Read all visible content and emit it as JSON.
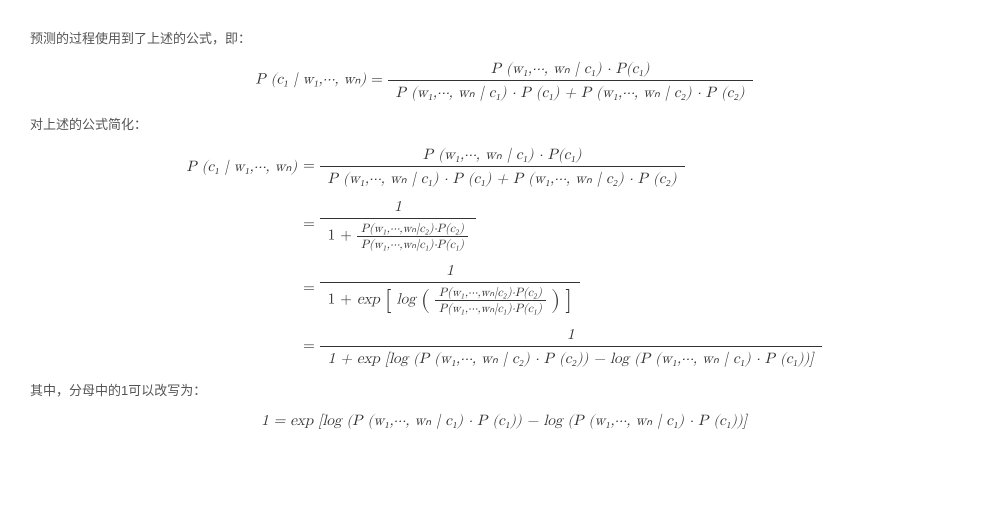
{
  "para1": "预测的过程使用到了上述的公式，即：",
  "para2": "对上述的公式简化：",
  "para3": "其中，分母中的1可以改写为：",
  "sym": {
    "P": "P",
    "c1": "c₁",
    "c2": "c₂",
    "w1": "w₁",
    "wn": "wₙ",
    "dots": "⋯",
    "given": " | ",
    "eq": " = ",
    "comma": ", ",
    "cdot": " · ",
    "plus": " + ",
    "minus": " − ",
    "one": "1",
    "exp": "exp",
    "log": "log"
  },
  "eq1_lhs": "P (c₁ | w₁,⋯, wₙ)",
  "eq1_num": "P (w₁,⋯, wₙ | c₁) · P(c₁)",
  "eq1_den": "P (w₁,⋯, wₙ | c₁) · P (c₁) + P (w₁,⋯, wₙ | c₂) · P (c₂)",
  "eq2_row1_num": "P (w₁,⋯, wₙ | c₁) · P(c₁)",
  "eq2_row1_den": "P (w₁,⋯, wₙ | c₁) · P (c₁) + P (w₁,⋯, wₙ | c₂) · P (c₂)",
  "eq2_row2_num": "1",
  "eq2_row2_inner_num": "P(w₁,⋯,wₙ|c₂)·P(c₂)",
  "eq2_row2_inner_den": "P(w₁,⋯,wₙ|c₁)·P(c₁)",
  "eq2_row3_num": "1",
  "eq2_row3_inner_num": "P(w₁,⋯,wₙ|c₂)·P(c₂)",
  "eq2_row3_inner_den": "P(w₁,⋯,wₙ|c₁)·P(c₁)",
  "eq2_row4_num": "1",
  "eq2_row4_den": "1 + exp [log (P (w₁,⋯, wₙ | c₂) · P (c₂)) − log (P (w₁,⋯, wₙ | c₁) · P (c₁))]",
  "eq3": "1 = exp [log (P (w₁,⋯, wₙ | c₁) · P (c₁)) − log (P (w₁,⋯, wₙ | c₁) · P (c₁))]"
}
